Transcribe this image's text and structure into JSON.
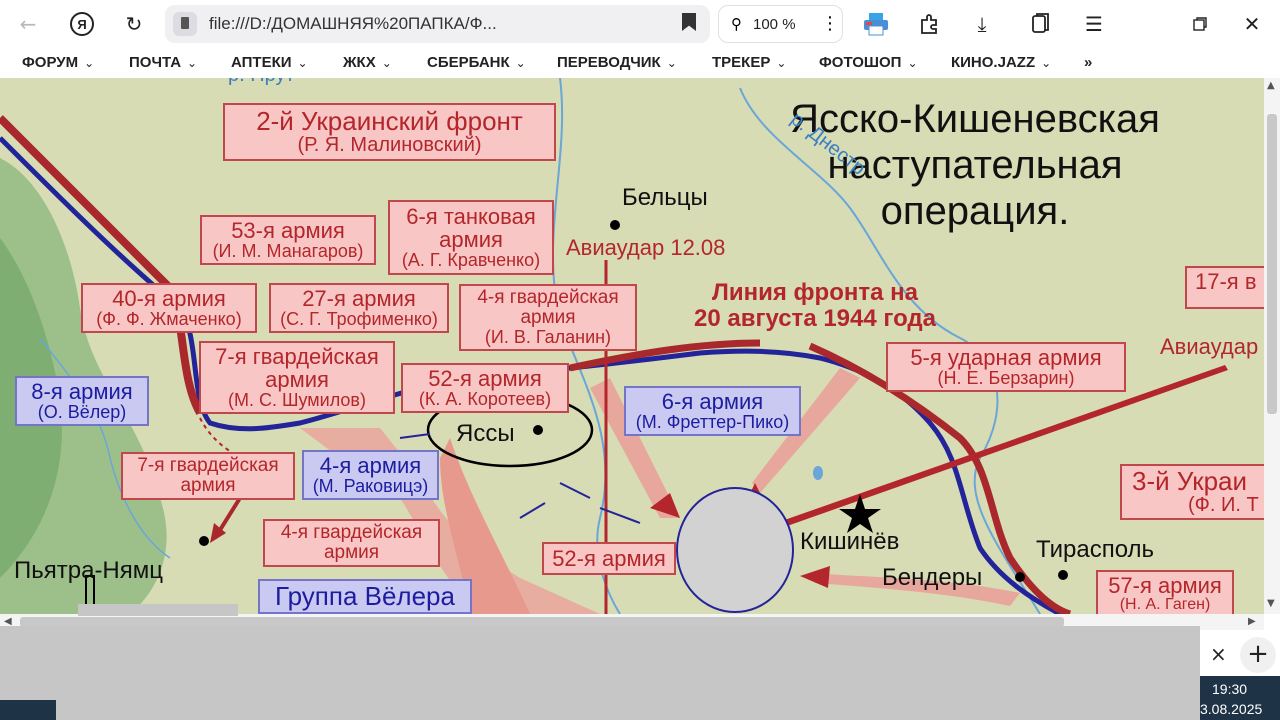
{
  "browser": {
    "url": "file:///D:/ДОМАШНЯЯ%20ПАПКА/Ф...",
    "zoom": "100 %",
    "icons": [
      "back-icon",
      "yandex-icon",
      "reload-icon",
      "file-icon",
      "bookmark-icon",
      "zoom-icon",
      "more-icon",
      "printer-icon",
      "extensions-icon",
      "download-icon",
      "collections-icon",
      "menu-icon",
      "restore-icon",
      "close-icon"
    ]
  },
  "bookmarks": [
    {
      "label": "ФОРУМ"
    },
    {
      "label": "ПОЧТА"
    },
    {
      "label": "АПТЕКИ"
    },
    {
      "label": "ЖКХ"
    },
    {
      "label": "СБЕРБАНК"
    },
    {
      "label": "ПЕРЕВОДЧИК"
    },
    {
      "label": "ТРЕКЕР"
    },
    {
      "label": "ФОТОШОП"
    },
    {
      "label": "КИНО.JAZZ"
    }
  ],
  "bookmarks_more": "»",
  "map": {
    "title_line1": "Ясско-Кишеневская",
    "title_line2": "наступательная",
    "title_line3": "операция.",
    "frontline_line1": "Линия фронта на",
    "frontline_line2": "20 августа 1944 года",
    "avia1": "Авиаудар 12.08",
    "avia2": "Авиаудар",
    "places": {
      "beltsy": "Бельцы",
      "iassy": "Яссы",
      "kishinev": "Кишинёв",
      "tiraspol": "Тирасполь",
      "bendery": "Бендеры",
      "piatra": "Пьятра-Нямц",
      "dniester": "р. Днестр",
      "prut": "р. Прут"
    },
    "armies": {
      "ukr2": {
        "name": "2-й Украинский фронт",
        "cmd": "(Р. Я. Малиновский)"
      },
      "a53": {
        "name": "53-я армия",
        "cmd": "(И. М. Манагаров)"
      },
      "t6": {
        "name1": "6-я танковая",
        "name2": "армия",
        "cmd": "(А. Г. Кравченко)"
      },
      "a40": {
        "name": "40-я армия",
        "cmd": "(Ф. Ф. Жмаченко)"
      },
      "a27": {
        "name": "27-я армия",
        "cmd": "(С. Г. Трофименко)"
      },
      "g4": {
        "name1": "4-я гвардейская",
        "name2": "армия",
        "cmd": "(И. В. Галанин)"
      },
      "g7": {
        "name1": "7-я гвардейская",
        "name2": "армия",
        "cmd": "(М. С. Шумилов)"
      },
      "a52": {
        "name": "52-я армия",
        "cmd": "(К. А. Коротеев)"
      },
      "u5": {
        "name": "5-я ударная армия",
        "cmd": "(Н. Е. Берзарин)"
      },
      "a17": {
        "name": "17-я в"
      },
      "ukr3": {
        "name": "3-й Украи",
        "cmd": "(Ф. И. Т"
      },
      "a57": {
        "name": "57-я армия",
        "cmd": "(Н. А. Гаген)"
      },
      "g7b": {
        "name1": "7-я гвардейская",
        "name2": "армия"
      },
      "g4b": {
        "name1": "4-я гвардейская",
        "name2": "армия"
      },
      "a52b": {
        "name": "52-я армия"
      }
    },
    "enemy": {
      "e8": {
        "name": "8-я армия",
        "cmd": "(О. Вёлер)"
      },
      "e6": {
        "name": "6-я армия",
        "cmd": "(М. Фреттер-Пико)"
      },
      "e4": {
        "name": "4-я армия",
        "cmd": "(М. Раковицэ)"
      },
      "group": {
        "name": "Группа Вёлера"
      }
    }
  },
  "system": {
    "time": "19:30",
    "date": "3.08.2025",
    "close": "×",
    "add": "+"
  }
}
